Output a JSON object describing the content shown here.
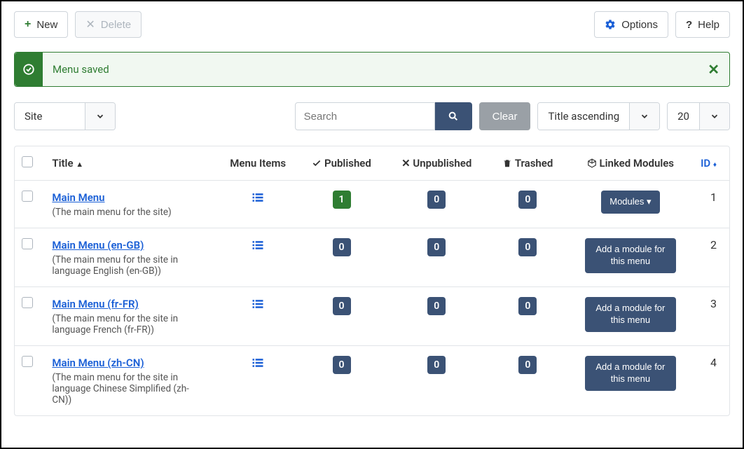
{
  "toolbar": {
    "new_label": "New",
    "delete_label": "Delete",
    "options_label": "Options",
    "help_label": "Help"
  },
  "alert": {
    "message": "Menu saved"
  },
  "filters": {
    "site_label": "Site",
    "search_placeholder": "Search",
    "clear_label": "Clear",
    "sort_label": "Title ascending",
    "per_page": "20"
  },
  "columns": {
    "title": "Title",
    "menu_items": "Menu Items",
    "published": "Published",
    "unpublished": "Unpublished",
    "trashed": "Trashed",
    "linked_modules": "Linked Modules",
    "id": "ID"
  },
  "rows": [
    {
      "title": "Main Menu",
      "desc": "(The main menu for the site)",
      "published": "1",
      "unpublished": "0",
      "trashed": "0",
      "module_label": "Modules",
      "module_dropdown": true,
      "id": "1",
      "published_green": true
    },
    {
      "title": "Main Menu (en-GB)",
      "desc": "(The main menu for the site in language English (en-GB))",
      "published": "0",
      "unpublished": "0",
      "trashed": "0",
      "module_label": "Add a module for this menu",
      "module_dropdown": false,
      "id": "2",
      "published_green": false
    },
    {
      "title": "Main Menu (fr-FR)",
      "desc": "(The main menu for the site in language French (fr-FR))",
      "published": "0",
      "unpublished": "0",
      "trashed": "0",
      "module_label": "Add a module for this menu",
      "module_dropdown": false,
      "id": "3",
      "published_green": false
    },
    {
      "title": "Main Menu (zh-CN)",
      "desc": "(The main menu for the site in language Chinese Simplified (zh-CN))",
      "published": "0",
      "unpublished": "0",
      "trashed": "0",
      "module_label": "Add a module for this menu",
      "module_dropdown": false,
      "id": "4",
      "published_green": false
    }
  ]
}
